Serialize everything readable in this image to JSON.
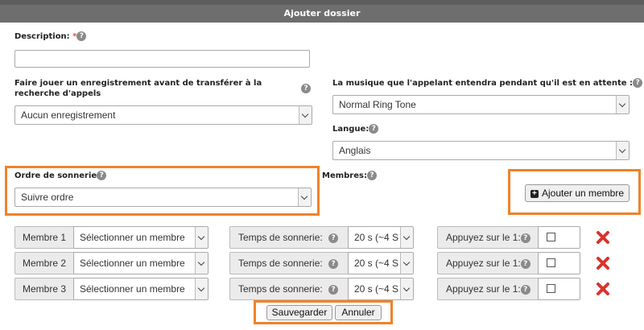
{
  "dialog": {
    "title": "Ajouter dossier"
  },
  "description": {
    "label": "Description: ",
    "required_mark": "*",
    "value": ""
  },
  "recording": {
    "label": "Faire jouer un enregistrement avant de transférer à la recherche d'appels",
    "value": "Aucun enregistrement"
  },
  "hold_music": {
    "label": "La musique que l'appelant entendra pendant qu'il est en attente :",
    "value": "Normal Ring Tone"
  },
  "language": {
    "label": "Langue:",
    "value": "Anglais"
  },
  "ring_order": {
    "label": "Ordre de sonnerie",
    "value": "Suivre ordre"
  },
  "members": {
    "label": "Membres:",
    "add_button": "Ajouter un membre",
    "rows": [
      {
        "member_label": "Membre 1",
        "member_value": "Sélectionner un membre",
        "ring_label": "Temps de sonnerie:",
        "ring_value": "20 s (~4 S",
        "press_label": "Appuyez sur le 1:",
        "checked": false
      },
      {
        "member_label": "Membre 2",
        "member_value": "Sélectionner un membre",
        "ring_label": "Temps de sonnerie:",
        "ring_value": "20 s (~4 S",
        "press_label": "Appuyez sur le 1:",
        "checked": false
      },
      {
        "member_label": "Membre 3",
        "member_value": "Sélectionner un membre",
        "ring_label": "Temps de sonnerie:",
        "ring_value": "20 s (~4 S",
        "press_label": "Appuyez sur le 1:",
        "checked": false
      }
    ]
  },
  "actions": {
    "save": "Sauvegarder",
    "cancel": "Annuler"
  },
  "colors": {
    "highlight": "#f0822a",
    "delete": "#d9332b",
    "titlebar": "#6e6e6e"
  },
  "icons": {
    "help": "question-circle-icon",
    "add": "plus-square-icon",
    "delete": "x-icon",
    "dropdown": "chevron-down-icon"
  }
}
